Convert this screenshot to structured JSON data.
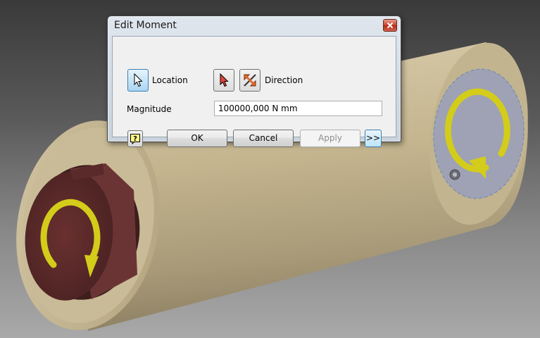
{
  "dialog": {
    "title": "Edit Moment",
    "location_label": "Location",
    "direction_label": "Direction",
    "magnitude_label": "Magnitude",
    "magnitude_value": "100000,000 N mm",
    "ok_label": "OK",
    "cancel_label": "Cancel",
    "apply_label": "Apply",
    "more_label": ">>"
  },
  "icons": {
    "close": "close-icon",
    "location_select": "cursor-arrow-icon",
    "direction_select": "cursor-arrow-red-icon",
    "flip_direction": "flip-direction-icon",
    "help": "help-icon"
  },
  "colors": {
    "cylinder_body": "#c9bb98",
    "bore_face": "#5b2a2a",
    "moment_arrow": "#d4cc1a",
    "selected_face": "#9aa0b5"
  }
}
